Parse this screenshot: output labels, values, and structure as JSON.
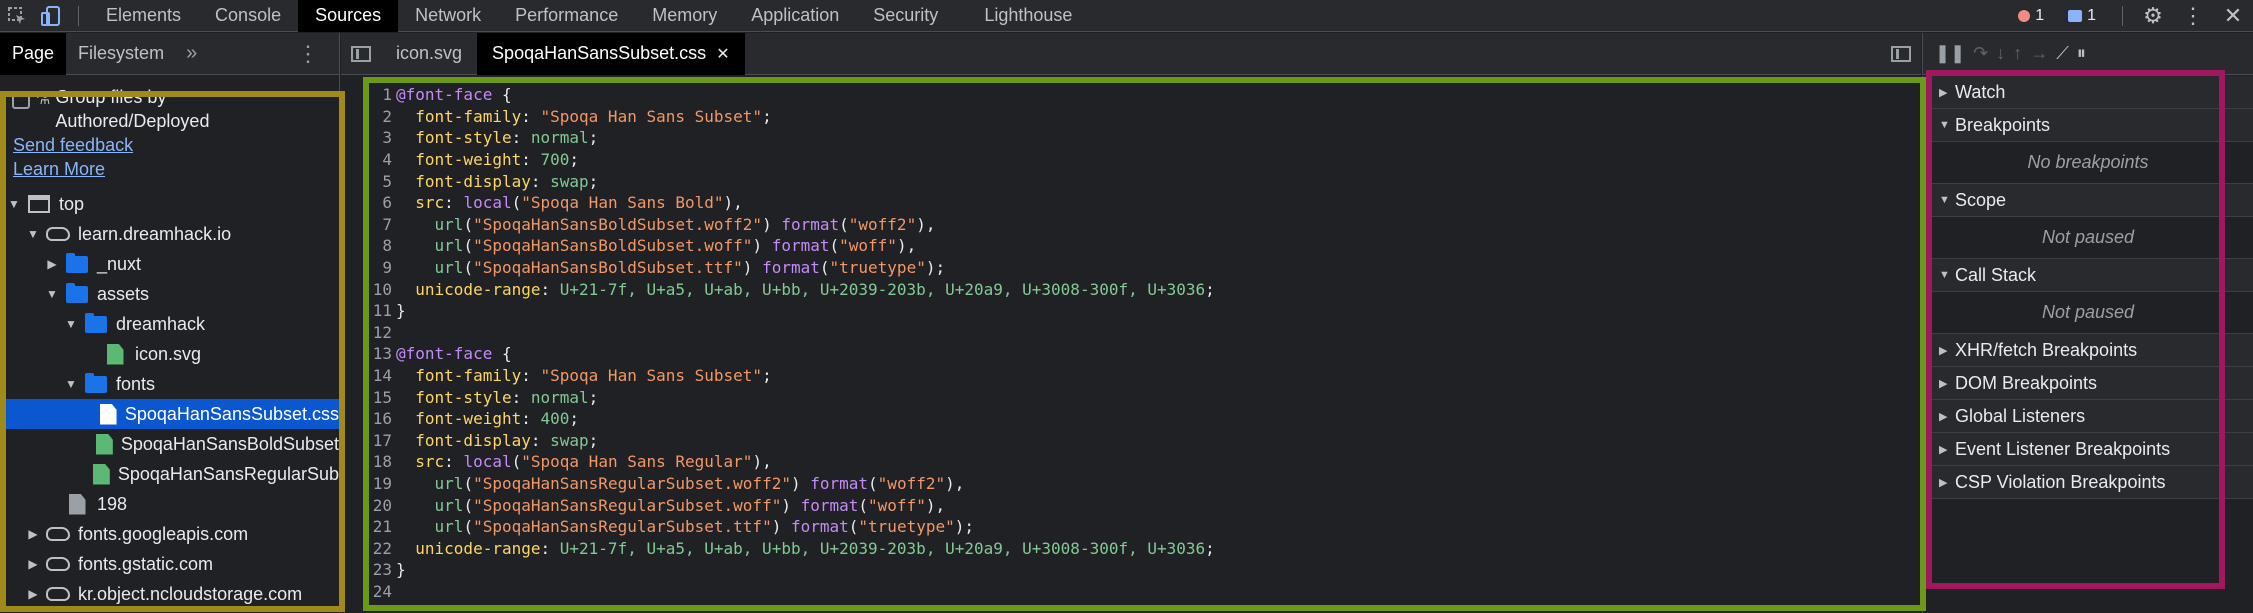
{
  "top_tabs": [
    "Elements",
    "Console",
    "Sources",
    "Network",
    "Performance",
    "Memory",
    "Application",
    "Security",
    "Lighthouse"
  ],
  "active_top_tab": "Sources",
  "status": {
    "errors": "1",
    "messages": "1"
  },
  "left_panel": {
    "tabs": [
      "Page",
      "Filesystem"
    ],
    "group_label": "Group files by Authored/Deployed",
    "send_feedback": "Send feedback",
    "learn_more": "Learn More",
    "tree": [
      {
        "label": "top",
        "depth": 0,
        "icon": "frame-icon",
        "arrow": "▼"
      },
      {
        "label": "learn.dreamhack.io",
        "depth": 1,
        "icon": "cloud-icon",
        "arrow": "▼"
      },
      {
        "label": "_nuxt",
        "depth": 2,
        "icon": "folder-icon",
        "arrow": "▶"
      },
      {
        "label": "assets",
        "depth": 2,
        "icon": "folder-icon",
        "arrow": "▼"
      },
      {
        "label": "dreamhack",
        "depth": 3,
        "icon": "folder-icon",
        "arrow": "▼"
      },
      {
        "label": "icon.svg",
        "depth": 4,
        "icon": "file-green-icon",
        "arrow": ""
      },
      {
        "label": "fonts",
        "depth": 3,
        "icon": "folder-icon",
        "arrow": "▼"
      },
      {
        "label": "SpoqaHanSansSubset.css",
        "depth": 4,
        "icon": "file-white-icon",
        "arrow": "",
        "selected": true
      },
      {
        "label": "SpoqaHanSansBoldSubset",
        "depth": 4,
        "icon": "file-green-icon",
        "arrow": ""
      },
      {
        "label": "SpoqaHanSansRegularSub",
        "depth": 4,
        "icon": "file-green-icon",
        "arrow": ""
      },
      {
        "label": "198",
        "depth": 2,
        "icon": "file-gray-icon",
        "arrow": ""
      },
      {
        "label": "fonts.googleapis.com",
        "depth": 1,
        "icon": "cloud-icon",
        "arrow": "▶"
      },
      {
        "label": "fonts.gstatic.com",
        "depth": 1,
        "icon": "cloud-icon",
        "arrow": "▶"
      },
      {
        "label": "kr.object.ncloudstorage.com",
        "depth": 1,
        "icon": "cloud-icon",
        "arrow": "▶"
      }
    ]
  },
  "editor": {
    "tabs": [
      "icon.svg",
      "SpoqaHanSansSubset.css"
    ],
    "active_tab": "SpoqaHanSansSubset.css",
    "lines": [
      [
        [
          "at",
          "@font-face"
        ],
        [
          "cd",
          " {"
        ]
      ],
      [
        [
          "cd",
          "  "
        ],
        [
          "pr",
          "font-family"
        ],
        [
          "cd",
          ": "
        ],
        [
          "st",
          "\"Spoqa Han Sans Subset\""
        ],
        [
          "cd",
          ";"
        ]
      ],
      [
        [
          "cd",
          "  "
        ],
        [
          "pr",
          "font-style"
        ],
        [
          "cd",
          ": "
        ],
        [
          "nm",
          "normal"
        ],
        [
          "cd",
          ";"
        ]
      ],
      [
        [
          "cd",
          "  "
        ],
        [
          "pr",
          "font-weight"
        ],
        [
          "cd",
          ": "
        ],
        [
          "nm",
          "700"
        ],
        [
          "cd",
          ";"
        ]
      ],
      [
        [
          "cd",
          "  "
        ],
        [
          "pr",
          "font-display"
        ],
        [
          "cd",
          ": "
        ],
        [
          "nm",
          "swap"
        ],
        [
          "cd",
          ";"
        ]
      ],
      [
        [
          "cd",
          "  "
        ],
        [
          "pr",
          "src"
        ],
        [
          "cd",
          ": "
        ],
        [
          "fn",
          "local"
        ],
        [
          "cd",
          "("
        ],
        [
          "st",
          "\"Spoqa Han Sans Bold\""
        ],
        [
          "cd",
          "),"
        ]
      ],
      [
        [
          "cd",
          "    "
        ],
        [
          "nm",
          "url"
        ],
        [
          "cd",
          "("
        ],
        [
          "st",
          "\"SpoqaHanSansBoldSubset.woff2\""
        ],
        [
          "cd",
          ") "
        ],
        [
          "fn",
          "format"
        ],
        [
          "cd",
          "("
        ],
        [
          "st",
          "\"woff2\""
        ],
        [
          "cd",
          "),"
        ]
      ],
      [
        [
          "cd",
          "    "
        ],
        [
          "nm",
          "url"
        ],
        [
          "cd",
          "("
        ],
        [
          "st",
          "\"SpoqaHanSansBoldSubset.woff\""
        ],
        [
          "cd",
          ") "
        ],
        [
          "fn",
          "format"
        ],
        [
          "cd",
          "("
        ],
        [
          "st",
          "\"woff\""
        ],
        [
          "cd",
          "),"
        ]
      ],
      [
        [
          "cd",
          "    "
        ],
        [
          "nm",
          "url"
        ],
        [
          "cd",
          "("
        ],
        [
          "st",
          "\"SpoqaHanSansBoldSubset.ttf\""
        ],
        [
          "cd",
          ") "
        ],
        [
          "fn",
          "format"
        ],
        [
          "cd",
          "("
        ],
        [
          "st",
          "\"truetype\""
        ],
        [
          "cd",
          ");"
        ]
      ],
      [
        [
          "cd",
          "  "
        ],
        [
          "pr",
          "unicode-range"
        ],
        [
          "cd",
          ": "
        ],
        [
          "nm",
          "U+21-7f, U+a5, U+ab, U+bb, U+2039-203b, U+20a9, U+3008-300f, U+3036"
        ],
        [
          "cd",
          ";"
        ]
      ],
      [
        [
          "cd",
          "}"
        ]
      ],
      [
        [
          "cd",
          ""
        ]
      ],
      [
        [
          "at",
          "@font-face"
        ],
        [
          "cd",
          " {"
        ]
      ],
      [
        [
          "cd",
          "  "
        ],
        [
          "pr",
          "font-family"
        ],
        [
          "cd",
          ": "
        ],
        [
          "st",
          "\"Spoqa Han Sans Subset\""
        ],
        [
          "cd",
          ";"
        ]
      ],
      [
        [
          "cd",
          "  "
        ],
        [
          "pr",
          "font-style"
        ],
        [
          "cd",
          ": "
        ],
        [
          "nm",
          "normal"
        ],
        [
          "cd",
          ";"
        ]
      ],
      [
        [
          "cd",
          "  "
        ],
        [
          "pr",
          "font-weight"
        ],
        [
          "cd",
          ": "
        ],
        [
          "nm",
          "400"
        ],
        [
          "cd",
          ";"
        ]
      ],
      [
        [
          "cd",
          "  "
        ],
        [
          "pr",
          "font-display"
        ],
        [
          "cd",
          ": "
        ],
        [
          "nm",
          "swap"
        ],
        [
          "cd",
          ";"
        ]
      ],
      [
        [
          "cd",
          "  "
        ],
        [
          "pr",
          "src"
        ],
        [
          "cd",
          ": "
        ],
        [
          "fn",
          "local"
        ],
        [
          "cd",
          "("
        ],
        [
          "st",
          "\"Spoqa Han Sans Regular\""
        ],
        [
          "cd",
          "),"
        ]
      ],
      [
        [
          "cd",
          "    "
        ],
        [
          "nm",
          "url"
        ],
        [
          "cd",
          "("
        ],
        [
          "st",
          "\"SpoqaHanSansRegularSubset.woff2\""
        ],
        [
          "cd",
          ") "
        ],
        [
          "fn",
          "format"
        ],
        [
          "cd",
          "("
        ],
        [
          "st",
          "\"woff2\""
        ],
        [
          "cd",
          "),"
        ]
      ],
      [
        [
          "cd",
          "    "
        ],
        [
          "nm",
          "url"
        ],
        [
          "cd",
          "("
        ],
        [
          "st",
          "\"SpoqaHanSansRegularSubset.woff\""
        ],
        [
          "cd",
          ") "
        ],
        [
          "fn",
          "format"
        ],
        [
          "cd",
          "("
        ],
        [
          "st",
          "\"woff\""
        ],
        [
          "cd",
          "),"
        ]
      ],
      [
        [
          "cd",
          "    "
        ],
        [
          "nm",
          "url"
        ],
        [
          "cd",
          "("
        ],
        [
          "st",
          "\"SpoqaHanSansRegularSubset.ttf\""
        ],
        [
          "cd",
          ") "
        ],
        [
          "fn",
          "format"
        ],
        [
          "cd",
          "("
        ],
        [
          "st",
          "\"truetype\""
        ],
        [
          "cd",
          ");"
        ]
      ],
      [
        [
          "cd",
          "  "
        ],
        [
          "pr",
          "unicode-range"
        ],
        [
          "cd",
          ": "
        ],
        [
          "nm",
          "U+21-7f, U+a5, U+ab, U+bb, U+2039-203b, U+20a9, U+3008-300f, U+3036"
        ],
        [
          "cd",
          ";"
        ]
      ],
      [
        [
          "cd",
          "}"
        ]
      ],
      [
        [
          "cd",
          ""
        ]
      ]
    ]
  },
  "debugger": {
    "sections": [
      {
        "title": "Watch",
        "expanded": false,
        "body": ""
      },
      {
        "title": "Breakpoints",
        "expanded": true,
        "body": "No breakpoints"
      },
      {
        "title": "Scope",
        "expanded": true,
        "body": "Not paused"
      },
      {
        "title": "Call Stack",
        "expanded": true,
        "body": "Not paused"
      },
      {
        "title": "XHR/fetch Breakpoints",
        "expanded": false,
        "body": ""
      },
      {
        "title": "DOM Breakpoints",
        "expanded": false,
        "body": ""
      },
      {
        "title": "Global Listeners",
        "expanded": false,
        "body": ""
      },
      {
        "title": "Event Listener Breakpoints",
        "expanded": false,
        "body": ""
      },
      {
        "title": "CSP Violation Breakpoints",
        "expanded": false,
        "body": ""
      }
    ]
  },
  "highlight_colors": {
    "left": "#a08a1c",
    "editor": "#6b9a1a",
    "debug": "#a2185f"
  }
}
